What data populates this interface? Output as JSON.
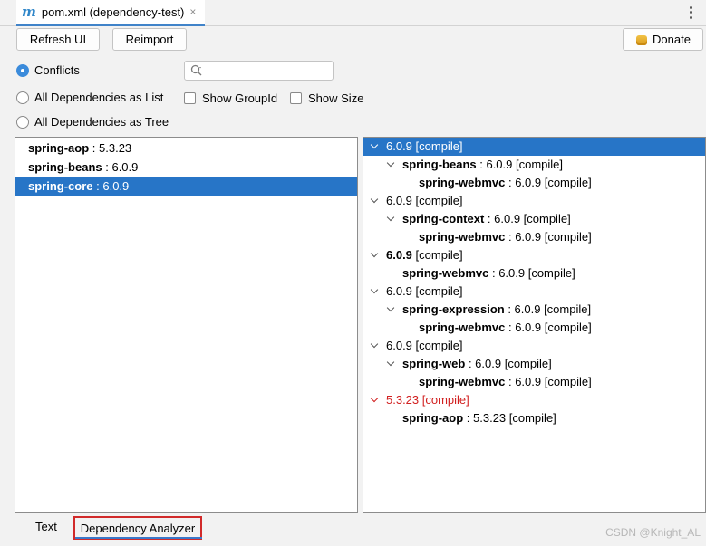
{
  "tab": {
    "icon": "m",
    "title": "pom.xml (dependency-test)",
    "close": "×"
  },
  "toolbar": {
    "refresh": "Refresh UI",
    "reimport": "Reimport",
    "donate": "Donate"
  },
  "options": {
    "conflicts": "Conflicts",
    "list": "All Dependencies as List",
    "tree": "All Dependencies as Tree",
    "show_groupid": "Show GroupId",
    "show_size": "Show Size",
    "selected": "Conflicts"
  },
  "search": {
    "placeholder": "",
    "value": ""
  },
  "left_list": [
    {
      "name": "spring-aop",
      "version": " : 5.3.23"
    },
    {
      "name": "spring-beans",
      "version": " : 6.0.9"
    },
    {
      "name": "spring-core",
      "version": " : 6.0.9"
    }
  ],
  "tree": [
    {
      "head": "6.0.9 [compile]",
      "bold": "",
      "rest": ""
    },
    {
      "head": "",
      "bold": "spring-beans",
      "rest": " : 6.0.9 [compile]"
    },
    {
      "head": "",
      "bold": "spring-webmvc",
      "rest": " : 6.0.9 [compile]"
    },
    {
      "head": "6.0.9 [compile]",
      "bold": "",
      "rest": ""
    },
    {
      "head": "",
      "bold": "spring-context",
      "rest": " : 6.0.9 [compile]"
    },
    {
      "head": "",
      "bold": "spring-webmvc",
      "rest": " : 6.0.9 [compile]"
    },
    {
      "head": "",
      "bold": "6.0.9",
      "rest": " [compile]"
    },
    {
      "head": "",
      "bold": "spring-webmvc",
      "rest": " : 6.0.9 [compile]"
    },
    {
      "head": "6.0.9 [compile]",
      "bold": "",
      "rest": ""
    },
    {
      "head": "",
      "bold": "spring-expression",
      "rest": " : 6.0.9 [compile]"
    },
    {
      "head": "",
      "bold": "spring-webmvc",
      "rest": " : 6.0.9 [compile]"
    },
    {
      "head": "6.0.9 [compile]",
      "bold": "",
      "rest": ""
    },
    {
      "head": "",
      "bold": "spring-web",
      "rest": " : 6.0.9 [compile]"
    },
    {
      "head": "",
      "bold": "spring-webmvc",
      "rest": " : 6.0.9 [compile]"
    },
    {
      "head": "5.3.23 [compile]",
      "bold": "",
      "rest": ""
    },
    {
      "head": "",
      "bold": "spring-aop",
      "rest": " : 5.3.23 [compile]"
    }
  ],
  "bottom_tabs": {
    "text": "Text",
    "analyzer": "Dependency Analyzer"
  },
  "watermark": "CSDN @Knight_AL",
  "colors": {
    "selection": "#2775c7",
    "conflict": "#d11f1f",
    "highlight_border": "#d12a2a"
  }
}
